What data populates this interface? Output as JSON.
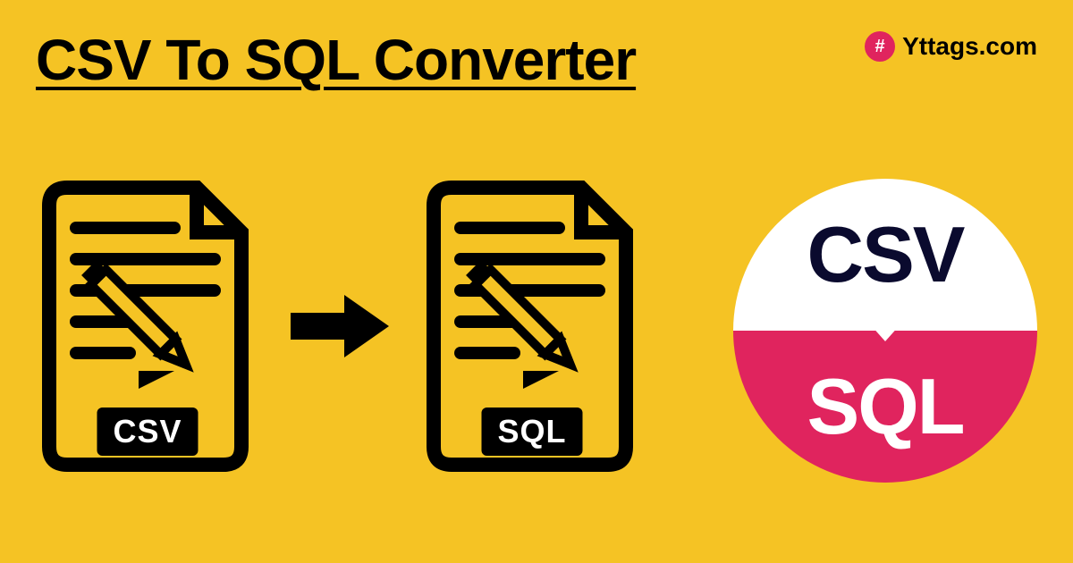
{
  "title": "CSV To SQL Converter",
  "brand": {
    "icon_symbol": "#",
    "text": "Yttags.com"
  },
  "doc1": {
    "label": "CSV"
  },
  "doc2": {
    "label": "SQL"
  },
  "badge": {
    "top": "CSV",
    "bottom": "SQL"
  }
}
